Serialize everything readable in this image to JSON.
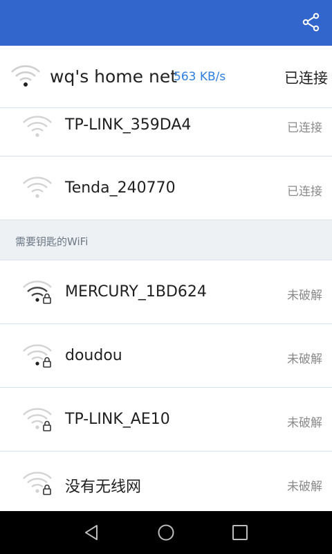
{
  "app_bar": {
    "bg_color": "#3366cc",
    "icons": [
      "share-icon"
    ]
  },
  "connected": {
    "ssid": "wq's home net",
    "speed": "563 KB/s",
    "status": "已连接",
    "icon": "wifi-icon"
  },
  "saved": [
    {
      "ssid": "TP-LINK_359DA4",
      "status": "已连接"
    },
    {
      "ssid": "Tenda_240770",
      "status": "已连接"
    }
  ],
  "section_title": "需要钥匙的WiFi",
  "locked": [
    {
      "ssid": "MERCURY_1BD624",
      "status": "未破解"
    },
    {
      "ssid": "doudou",
      "status": "未破解"
    },
    {
      "ssid": "TP-LINK_AE10",
      "status": "未破解"
    },
    {
      "ssid": "没有无线网",
      "status": "未破解"
    }
  ],
  "nav": {
    "icons": [
      "back-icon",
      "home-icon",
      "recents-icon"
    ]
  },
  "colors": {
    "accent": "#3366cc",
    "speed": "#2d7ee0",
    "status_gray": "#8a8a8a"
  }
}
